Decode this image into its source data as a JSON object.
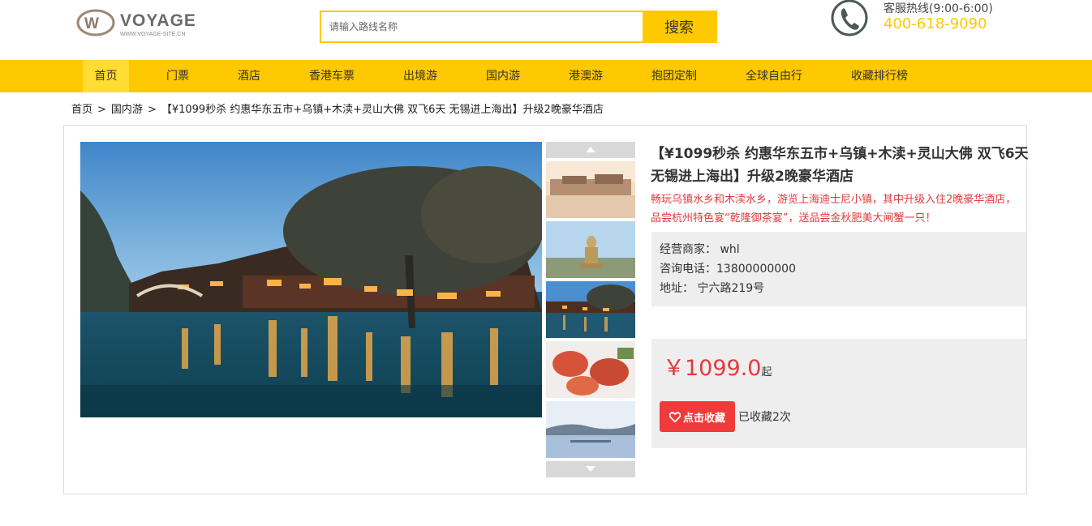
{
  "header": {
    "logo_text": "VOYAGE",
    "logo_subtext": "WWW.VOYAGE-SITE.CN",
    "search_placeholder": "请输入路线名称",
    "search_value": "",
    "search_button": "搜索",
    "hotline_icon": "phone-icon",
    "hotline_label": "客服热线(9:00-6:00)",
    "hotline_number": "400-618-9090"
  },
  "nav": {
    "items": [
      {
        "label": "首页",
        "active": true
      },
      {
        "label": "门票"
      },
      {
        "label": "酒店"
      },
      {
        "label": "香港车票"
      },
      {
        "label": "出境游"
      },
      {
        "label": "国内游"
      },
      {
        "label": "港澳游"
      },
      {
        "label": "抱团定制"
      },
      {
        "label": "全球自由行"
      },
      {
        "label": "收藏排行榜"
      }
    ]
  },
  "breadcrumb": {
    "items": [
      "首页",
      "国内游",
      "【¥1099秒杀 约惠华东五市+乌镇+木渎+灵山大佛 双飞6天 无锡进上海出】升级2晚豪华酒店"
    ],
    "separator": ">"
  },
  "gallery": {
    "up_icon": "arrow-up-icon",
    "down_icon": "arrow-down-icon"
  },
  "product": {
    "title": "【¥1099秒杀 约惠华东五市+乌镇+木渎+灵山大佛 双飞6天 无锡进上海出】升级2晚豪华酒店",
    "description": "畅玩乌镇水乡和木渎水乡，游览上海迪士尼小镇，其中升级入住2晚豪华酒店，品尝杭州特色宴“乾隆御茶宴”，送品尝金秋肥美大闸蟹一只！",
    "merchant_line": "经营商家：  whl",
    "phone_line": "咨询电话：13800000000",
    "address_line": "地址：   宁六路219号",
    "price": "￥1099.0",
    "price_suffix": "起",
    "favorite_button": "点击收藏",
    "favorite_icon": "heart-icon",
    "favorite_count": "已收藏2次"
  },
  "colors": {
    "accent": "#ffc900",
    "price_red": "#e4393c",
    "button_red": "#ef3b3b",
    "panel_gray": "#eeeeee"
  }
}
